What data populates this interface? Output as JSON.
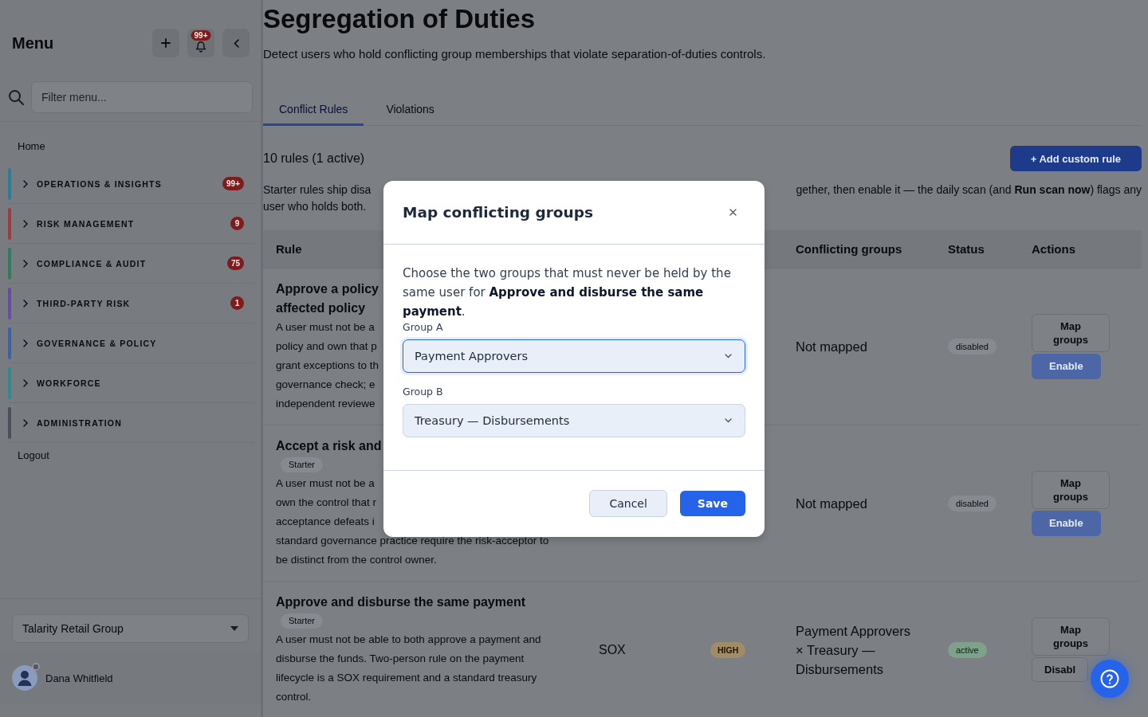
{
  "sidebar": {
    "title": "Menu",
    "notification_count": "99+",
    "filter_placeholder": "Filter menu...",
    "home": "Home",
    "sections": [
      {
        "label": "OPERATIONS & INSIGHTS",
        "color": "#2c7d99",
        "badge": "99+",
        "expanded": false
      },
      {
        "label": "RISK MANAGEMENT",
        "color": "#a13a3f",
        "badge": "9",
        "expanded": false
      },
      {
        "label": "COMPLIANCE & AUDIT",
        "color": "#2f7d5c",
        "badge": "75",
        "expanded": false
      },
      {
        "label": "THIRD-PARTY RISK",
        "color": "#6a4aa6",
        "badge": "1",
        "expanded": false
      },
      {
        "label": "GOVERNANCE & POLICY",
        "color": "#3d5fa6",
        "expanded": false
      },
      {
        "label": "WORKFORCE",
        "color": "#2e8a8c",
        "expanded": false
      },
      {
        "label": "ADMINISTRATION",
        "color": "#4a4f5a",
        "expanded": false
      }
    ],
    "logout": "Logout",
    "organization": "Talarity Retail Group",
    "user": "Dana Whitfield"
  },
  "page": {
    "title": "Segregation of Duties",
    "subtitle": "Detect users who hold conflicting group memberships that violate separation-of-duties controls.",
    "tabs": [
      {
        "label": "Conflict Rules",
        "selected": true
      },
      {
        "label": "Violations",
        "selected": false
      }
    ],
    "rule_count": "10 rules (1 active)",
    "add_button": "+ Add custom rule",
    "info": {
      "line_1_start": "Starter rules ship disa",
      "line_1_end": "gether, then enable it — the daily scan (and **Run scan now**) flags any",
      "line_2": "user who holds both."
    }
  },
  "table": {
    "columns": [
      "Rule",
      "Conflicting groups",
      "Status",
      "Actions"
    ],
    "rows": [
      {
        "title_lines": [
          "Approve a policy",
          "affected policy"
        ],
        "description_lines": [
          "A user must not be a",
          "policy and own that p",
          "grant exceptions to th",
          "governance check; e",
          "independent reviewe"
        ],
        "conflicting_groups": "Not mapped",
        "status": "disabled",
        "active": false,
        "actions": [
          {
            "label": "Map groups",
            "kind": "outline",
            "disabled": false
          },
          {
            "label": "Enable",
            "kind": "primary",
            "disabled": true
          }
        ]
      },
      {
        "title_lines": [
          "Accept a risk and"
        ],
        "badge": "Starter",
        "description_lines": [
          "A user must not be a",
          "own the control that r",
          "acceptance defeats i",
          "standard governance practice require the risk-acceptor to",
          "be distinct from the control owner."
        ],
        "conflicting_groups": "Not mapped",
        "status": "disabled",
        "active": false,
        "actions": [
          {
            "label": "Map groups",
            "kind": "outline",
            "disabled": false
          },
          {
            "label": "Enable",
            "kind": "primary",
            "disabled": true
          }
        ]
      },
      {
        "title_lines": [
          "Approve and disburse the same payment"
        ],
        "badge": "Starter",
        "description_lines": [
          "A user must not be able to both approve a payment and",
          "disburse the funds. Two-person rule on the payment",
          "lifecycle is a SOX requirement and a standard treasury",
          "control."
        ],
        "framework": "SOX",
        "severity": "HIGH",
        "conflicting_groups": "Payment Approvers × Treasury — Disbursements",
        "status": "active",
        "active": true,
        "actions": [
          {
            "label": "Map groups",
            "kind": "outline",
            "disabled": false
          },
          {
            "label": "Disabl",
            "kind": "outline",
            "disabled": false
          }
        ]
      }
    ]
  },
  "modal": {
    "title": "Map conflicting groups",
    "intro": "Choose the two groups that must never be held by the same user for **Approve and disburse the same payment**.",
    "fields": [
      {
        "label": "Group A",
        "value": "Payment Approvers",
        "focused": true
      },
      {
        "label": "Group B",
        "value": "Treasury — Disbursements",
        "focused": false
      }
    ],
    "buttons": [
      {
        "label": "Cancel",
        "kind": "secondary"
      },
      {
        "label": "Save",
        "kind": "primary"
      }
    ]
  }
}
